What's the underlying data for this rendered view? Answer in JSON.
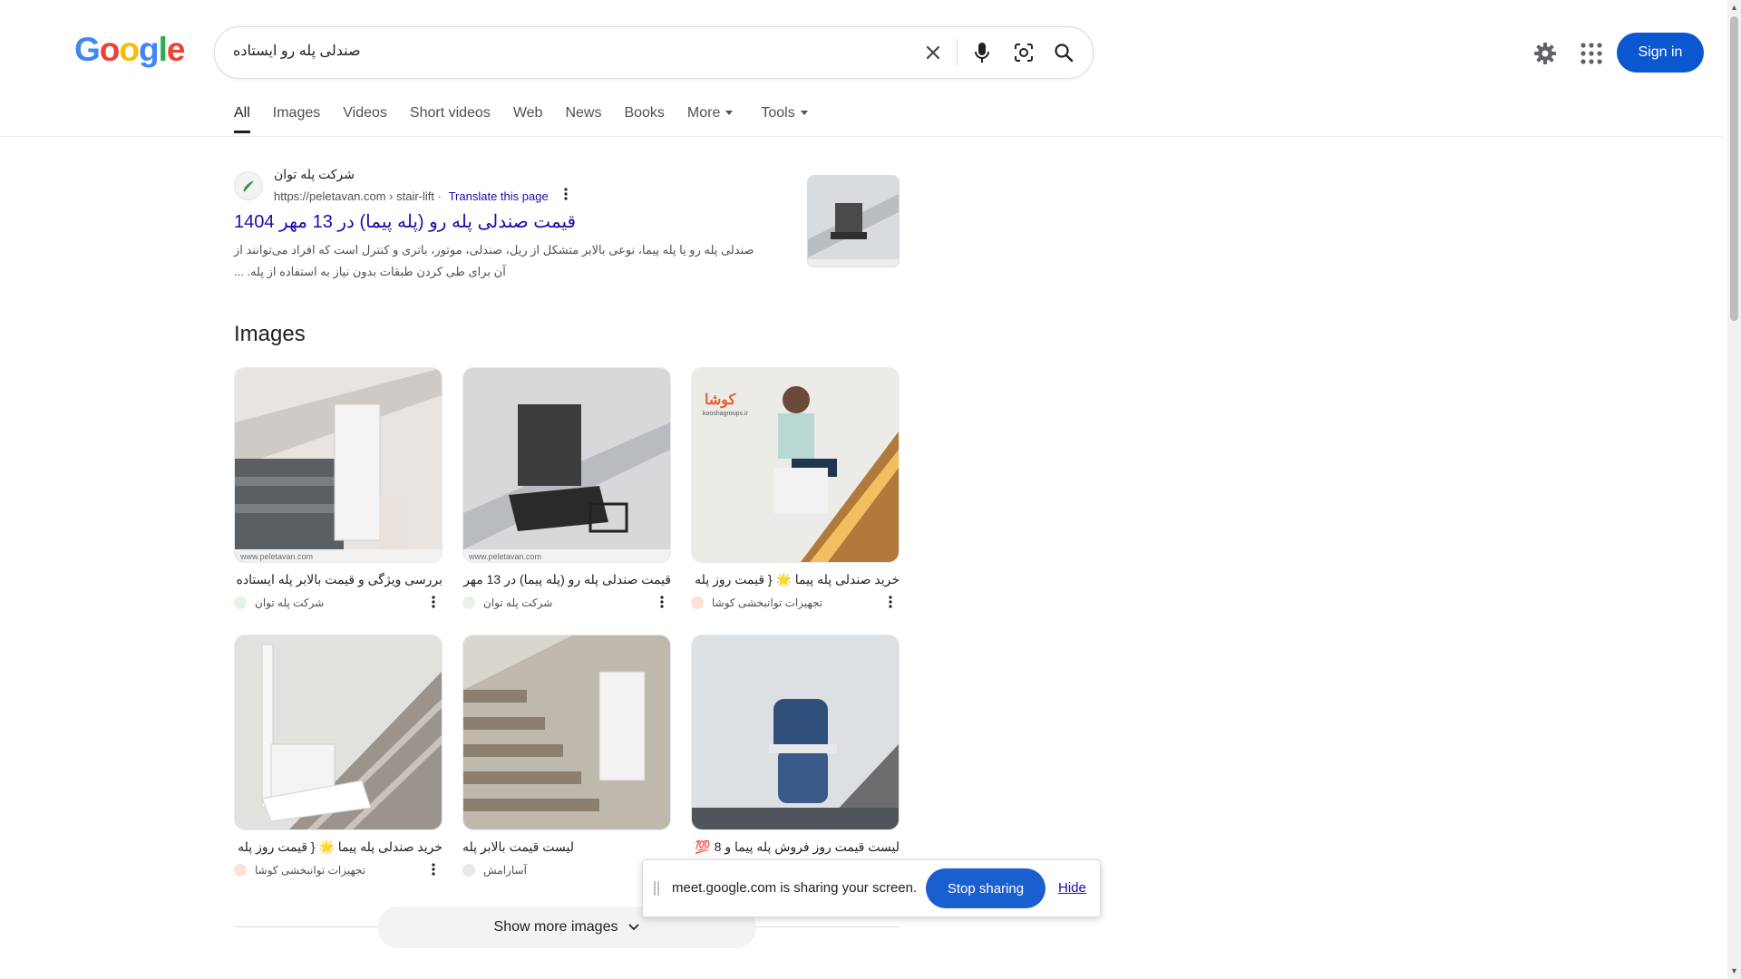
{
  "logo": {
    "letters": [
      "G",
      "o",
      "o",
      "g",
      "l",
      "e"
    ],
    "colors": [
      "#4285f4",
      "#ea4335",
      "#fbbc05",
      "#4285f4",
      "#34a853",
      "#ea4335"
    ]
  },
  "search": {
    "query": "صندلی پله رو ایستاده"
  },
  "header": {
    "signin_label": "Sign in"
  },
  "tabs": {
    "all": "All",
    "images": "Images",
    "videos": "Videos",
    "short_videos": "Short videos",
    "web": "Web",
    "news": "News",
    "books": "Books",
    "more": "More",
    "tools": "Tools"
  },
  "result": {
    "site_name": "شرکت پله توان",
    "url": "https://peletavan.com › stair-lift",
    "translate": "Translate this page",
    "title": "قیمت صندلی پله رو (پله پیما) در 13 مهر 1404",
    "snippet": "صندلی پله رو یا پله پیما، نوعی بالابر متشکل از ریل، صندلی، موتور، باتری و کنترل است که افراد می‌توانند از آن برای طی کردن طبقات بدون نیاز به استفاده از پله. ..."
  },
  "images_section": {
    "heading": "Images",
    "cards": [
      {
        "caption": "بررسی ویژگی و قیمت بالابر پله ایستاده - ...",
        "source": "شرکت پله توان",
        "watermark": "www.peletavan.com"
      },
      {
        "caption": "قیمت صندلی پله رو (پله پیما) در 13 مهر ...",
        "source": "شرکت پله توان",
        "watermark": "www.peletavan.com"
      },
      {
        "caption": "خرید صندلی پله پیما 🌟 { قیمت روز پله ...",
        "source": "تجهیزات توانبخشی کوشا",
        "watermark": "kooshagroups.ir"
      },
      {
        "caption": "خرید صندلی پله پیما 🌟 { قیمت روز پله ...",
        "source": "تجهیزات توانبخشی کوشا",
        "watermark": ""
      },
      {
        "caption": "لیست قیمت بالابر پله",
        "source": "آسارامش",
        "watermark": ""
      },
      {
        "caption": "لیست قیمت روز فروش پله پیما و 8 💯 ...",
        "source": "",
        "watermark": ""
      }
    ],
    "show_more": "Show more images"
  },
  "share_bar": {
    "message": "meet.google.com is sharing your screen.",
    "stop": "Stop sharing",
    "hide": "Hide"
  },
  "icons": {
    "clear": "close-icon",
    "voice": "microphone-icon",
    "lens": "camera-lens-icon",
    "search": "search-icon",
    "settings": "gear-icon",
    "apps": "apps-grid-icon"
  }
}
